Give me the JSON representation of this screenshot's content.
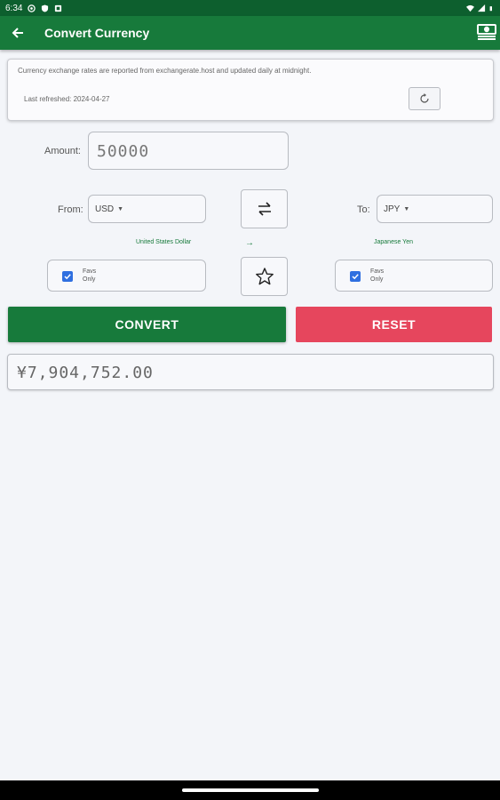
{
  "status_bar": {
    "time": "6:34"
  },
  "app_bar": {
    "title": "Convert Currency"
  },
  "info": {
    "message": "Currency exchange rates are reported from exchangerate.host and updated daily at midnight.",
    "last_refreshed": "Last refreshed: 2024-04-27"
  },
  "amount": {
    "label": "Amount:",
    "value": "50000"
  },
  "from": {
    "label": "From:",
    "code": "USD",
    "name": "United States Dollar"
  },
  "to": {
    "label": "To:",
    "code": "JPY",
    "name": "Japanese Yen"
  },
  "direction_arrow": "→",
  "favs": {
    "left": {
      "line1": "Favs",
      "line2": "Only",
      "checked": true
    },
    "right": {
      "line1": "Favs",
      "line2": "Only",
      "checked": true
    }
  },
  "buttons": {
    "convert": "CONVERT",
    "reset": "RESET"
  },
  "result": "¥7,904,752.00",
  "colors": {
    "primary": "#177a3b",
    "status_bar": "#0d5f2e",
    "reset": "#e6465d",
    "checkbox": "#2f6fe0",
    "background": "#f3f5f9"
  }
}
